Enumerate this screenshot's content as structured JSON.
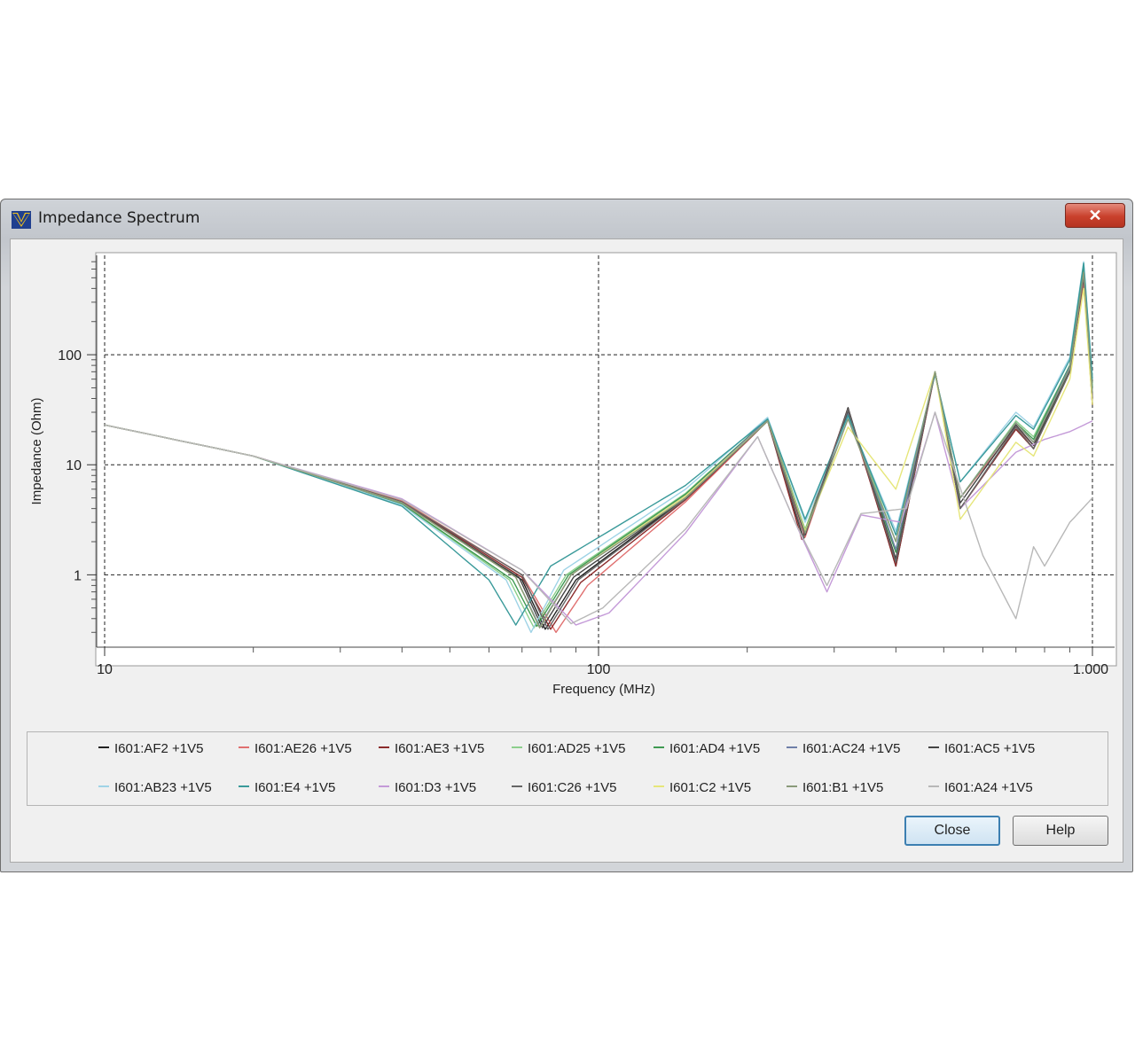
{
  "window": {
    "title": "Impedance Spectrum",
    "close_glyph": "✕"
  },
  "buttons": {
    "close_label": "Close",
    "help_label": "Help"
  },
  "chart_data": {
    "type": "line",
    "xlabel": "Frequency (MHz)",
    "ylabel": "Impedance (Ohm)",
    "xscale": "log",
    "yscale": "log",
    "xlim": [
      10,
      1000
    ],
    "ylim": [
      0.22,
      800
    ],
    "x_ticks": [
      {
        "value": 10,
        "label": "10"
      },
      {
        "value": 100,
        "label": "100"
      },
      {
        "value": 1000,
        "label": "1.000"
      }
    ],
    "y_ticks": [
      {
        "value": 1,
        "label": "1"
      },
      {
        "value": 10,
        "label": "10"
      },
      {
        "value": 100,
        "label": "100"
      }
    ],
    "grid": true,
    "legend_placement": "bottom",
    "series": [
      {
        "name": "I601:AF2 +1V5",
        "color": "#222222",
        "points": [
          [
            10,
            23
          ],
          [
            20,
            12
          ],
          [
            40,
            4.5
          ],
          [
            70,
            0.9
          ],
          [
            78,
            0.32
          ],
          [
            90,
            0.9
          ],
          [
            150,
            5
          ],
          [
            220,
            25
          ],
          [
            260,
            2.1
          ],
          [
            320,
            33
          ],
          [
            400,
            1.2
          ],
          [
            480,
            70
          ],
          [
            540,
            4
          ],
          [
            700,
            22
          ],
          [
            760,
            14
          ],
          [
            900,
            70
          ],
          [
            960,
            550
          ],
          [
            1000,
            35
          ]
        ]
      },
      {
        "name": "I601:AE26 +1V5",
        "color": "#e07070",
        "points": [
          [
            10,
            23
          ],
          [
            20,
            12
          ],
          [
            40,
            4.7
          ],
          [
            70,
            1.0
          ],
          [
            82,
            0.3
          ],
          [
            95,
            0.8
          ],
          [
            150,
            4.6
          ],
          [
            220,
            25
          ],
          [
            262,
            2.2
          ],
          [
            320,
            30
          ],
          [
            400,
            1.3
          ],
          [
            480,
            68
          ],
          [
            540,
            5
          ],
          [
            700,
            22
          ],
          [
            760,
            15
          ],
          [
            900,
            75
          ],
          [
            960,
            450
          ],
          [
            1000,
            40
          ]
        ]
      },
      {
        "name": "I601:AE3 +1V5",
        "color": "#8b2c2c",
        "points": [
          [
            10,
            23
          ],
          [
            20,
            12
          ],
          [
            40,
            4.6
          ],
          [
            70,
            0.95
          ],
          [
            80,
            0.32
          ],
          [
            92,
            0.85
          ],
          [
            150,
            4.8
          ],
          [
            220,
            25
          ],
          [
            258,
            2.1
          ],
          [
            320,
            32
          ],
          [
            400,
            1.2
          ],
          [
            480,
            70
          ],
          [
            540,
            4
          ],
          [
            700,
            21
          ],
          [
            760,
            14
          ],
          [
            900,
            70
          ],
          [
            960,
            500
          ],
          [
            1000,
            35
          ]
        ]
      },
      {
        "name": "I601:AD25 +1V5",
        "color": "#8ccf8c",
        "points": [
          [
            10,
            23
          ],
          [
            20,
            12
          ],
          [
            40,
            4.4
          ],
          [
            66,
            0.9
          ],
          [
            74,
            0.33
          ],
          [
            86,
            1.0
          ],
          [
            150,
            5.5
          ],
          [
            220,
            26
          ],
          [
            262,
            2.6
          ],
          [
            320,
            29
          ],
          [
            400,
            2
          ],
          [
            480,
            70
          ],
          [
            540,
            5
          ],
          [
            700,
            25
          ],
          [
            760,
            18
          ],
          [
            900,
            80
          ],
          [
            960,
            600
          ],
          [
            1000,
            50
          ]
        ]
      },
      {
        "name": "I601:AD4 +1V5",
        "color": "#3f9a52",
        "points": [
          [
            10,
            23
          ],
          [
            20,
            12
          ],
          [
            40,
            4.4
          ],
          [
            67,
            0.9
          ],
          [
            75,
            0.34
          ],
          [
            87,
            1.0
          ],
          [
            150,
            5.4
          ],
          [
            220,
            26
          ],
          [
            262,
            2.5
          ],
          [
            320,
            29
          ],
          [
            400,
            1.6
          ],
          [
            480,
            70
          ],
          [
            540,
            5
          ],
          [
            700,
            24
          ],
          [
            760,
            17
          ],
          [
            900,
            80
          ],
          [
            960,
            600
          ],
          [
            1000,
            50
          ]
        ]
      },
      {
        "name": "I601:AC24 +1V5",
        "color": "#6f7fa8",
        "points": [
          [
            10,
            23
          ],
          [
            20,
            12
          ],
          [
            40,
            4.5
          ],
          [
            68,
            0.95
          ],
          [
            76,
            0.34
          ],
          [
            88,
            1.0
          ],
          [
            150,
            5.2
          ],
          [
            220,
            26
          ],
          [
            262,
            2.4
          ],
          [
            320,
            30
          ],
          [
            400,
            1.7
          ],
          [
            480,
            70
          ],
          [
            540,
            5
          ],
          [
            700,
            24
          ],
          [
            760,
            16
          ],
          [
            900,
            78
          ],
          [
            960,
            520
          ],
          [
            1000,
            45
          ]
        ]
      },
      {
        "name": "I601:AC5 +1V5",
        "color": "#444444",
        "points": [
          [
            10,
            23
          ],
          [
            20,
            12
          ],
          [
            40,
            4.5
          ],
          [
            69,
            0.95
          ],
          [
            77,
            0.33
          ],
          [
            89,
            0.95
          ],
          [
            150,
            5.0
          ],
          [
            220,
            25
          ],
          [
            262,
            2.3
          ],
          [
            320,
            31
          ],
          [
            400,
            1.4
          ],
          [
            480,
            70
          ],
          [
            540,
            4.5
          ],
          [
            700,
            23
          ],
          [
            760,
            15
          ],
          [
            900,
            72
          ],
          [
            960,
            520
          ],
          [
            1000,
            40
          ]
        ]
      },
      {
        "name": "I601:AB23 +1V5",
        "color": "#9fd3e6",
        "points": [
          [
            10,
            23
          ],
          [
            20,
            12
          ],
          [
            40,
            4.3
          ],
          [
            65,
            0.9
          ],
          [
            73,
            0.3
          ],
          [
            85,
            1.1
          ],
          [
            150,
            6
          ],
          [
            220,
            27
          ],
          [
            262,
            3
          ],
          [
            320,
            27
          ],
          [
            400,
            2.5
          ],
          [
            480,
            66
          ],
          [
            540,
            7
          ],
          [
            700,
            30
          ],
          [
            760,
            22
          ],
          [
            900,
            95
          ],
          [
            960,
            700
          ],
          [
            1000,
            60
          ]
        ]
      },
      {
        "name": "I601:E4 +1V5",
        "color": "#3a9a9a",
        "points": [
          [
            10,
            23
          ],
          [
            20,
            12
          ],
          [
            40,
            4.2
          ],
          [
            60,
            0.9
          ],
          [
            68,
            0.35
          ],
          [
            80,
            1.2
          ],
          [
            150,
            6.5
          ],
          [
            220,
            26
          ],
          [
            262,
            3.2
          ],
          [
            320,
            28
          ],
          [
            400,
            2.3
          ],
          [
            480,
            66
          ],
          [
            540,
            7
          ],
          [
            700,
            28
          ],
          [
            760,
            21
          ],
          [
            900,
            90
          ],
          [
            960,
            680
          ],
          [
            1000,
            60
          ]
        ]
      },
      {
        "name": "I601:D3 +1V5",
        "color": "#c49ad8",
        "points": [
          [
            10,
            23
          ],
          [
            20,
            12
          ],
          [
            40,
            4.9
          ],
          [
            70,
            1.1
          ],
          [
            90,
            0.35
          ],
          [
            105,
            0.45
          ],
          [
            150,
            2.4
          ],
          [
            210,
            18
          ],
          [
            250,
            3
          ],
          [
            290,
            0.7
          ],
          [
            340,
            3.5
          ],
          [
            410,
            3
          ],
          [
            480,
            30
          ],
          [
            540,
            4
          ],
          [
            700,
            13
          ],
          [
            800,
            17
          ],
          [
            900,
            20
          ],
          [
            1000,
            25
          ]
        ]
      },
      {
        "name": "I601:C26 +1V5",
        "color": "#666666",
        "points": [
          [
            10,
            23
          ],
          [
            20,
            12
          ],
          [
            40,
            4.6
          ],
          [
            70,
            1.0
          ],
          [
            79,
            0.32
          ],
          [
            91,
            0.9
          ],
          [
            150,
            4.9
          ],
          [
            220,
            25
          ],
          [
            260,
            2.2
          ],
          [
            320,
            32
          ],
          [
            400,
            1.3
          ],
          [
            480,
            70
          ],
          [
            540,
            4
          ],
          [
            700,
            22
          ],
          [
            760,
            14
          ],
          [
            900,
            70
          ],
          [
            960,
            520
          ],
          [
            1000,
            36
          ]
        ]
      },
      {
        "name": "I601:C2 +1V5",
        "color": "#e6e67a",
        "points": [
          [
            10,
            23
          ],
          [
            20,
            12
          ],
          [
            40,
            4.5
          ],
          [
            68,
            0.95
          ],
          [
            76,
            0.33
          ],
          [
            88,
            1.0
          ],
          [
            150,
            5.2
          ],
          [
            220,
            25
          ],
          [
            262,
            2.5
          ],
          [
            320,
            22
          ],
          [
            400,
            6
          ],
          [
            480,
            70
          ],
          [
            540,
            3.2
          ],
          [
            700,
            16
          ],
          [
            760,
            12
          ],
          [
            900,
            60
          ],
          [
            960,
            400
          ],
          [
            1000,
            35
          ]
        ]
      },
      {
        "name": "I601:B1 +1V5",
        "color": "#8a9a7a",
        "points": [
          [
            10,
            23
          ],
          [
            20,
            12
          ],
          [
            40,
            4.5
          ],
          [
            68,
            0.95
          ],
          [
            76,
            0.33
          ],
          [
            88,
            1.0
          ],
          [
            150,
            5.0
          ],
          [
            220,
            25
          ],
          [
            262,
            2.4
          ],
          [
            320,
            26
          ],
          [
            400,
            2
          ],
          [
            480,
            70
          ],
          [
            540,
            5
          ],
          [
            700,
            24
          ],
          [
            760,
            16
          ],
          [
            900,
            75
          ],
          [
            960,
            560
          ],
          [
            1000,
            45
          ]
        ]
      },
      {
        "name": "I601:A24 +1V5",
        "color": "#b8b8b8",
        "points": [
          [
            10,
            23
          ],
          [
            20,
            12
          ],
          [
            40,
            4.8
          ],
          [
            70,
            1.1
          ],
          [
            88,
            0.36
          ],
          [
            102,
            0.5
          ],
          [
            150,
            2.6
          ],
          [
            210,
            18
          ],
          [
            250,
            3
          ],
          [
            290,
            0.8
          ],
          [
            340,
            3.6
          ],
          [
            420,
            4
          ],
          [
            480,
            30
          ],
          [
            600,
            1.5
          ],
          [
            700,
            0.4
          ],
          [
            760,
            1.8
          ],
          [
            800,
            1.2
          ],
          [
            900,
            3
          ],
          [
            1000,
            5
          ]
        ]
      }
    ]
  }
}
